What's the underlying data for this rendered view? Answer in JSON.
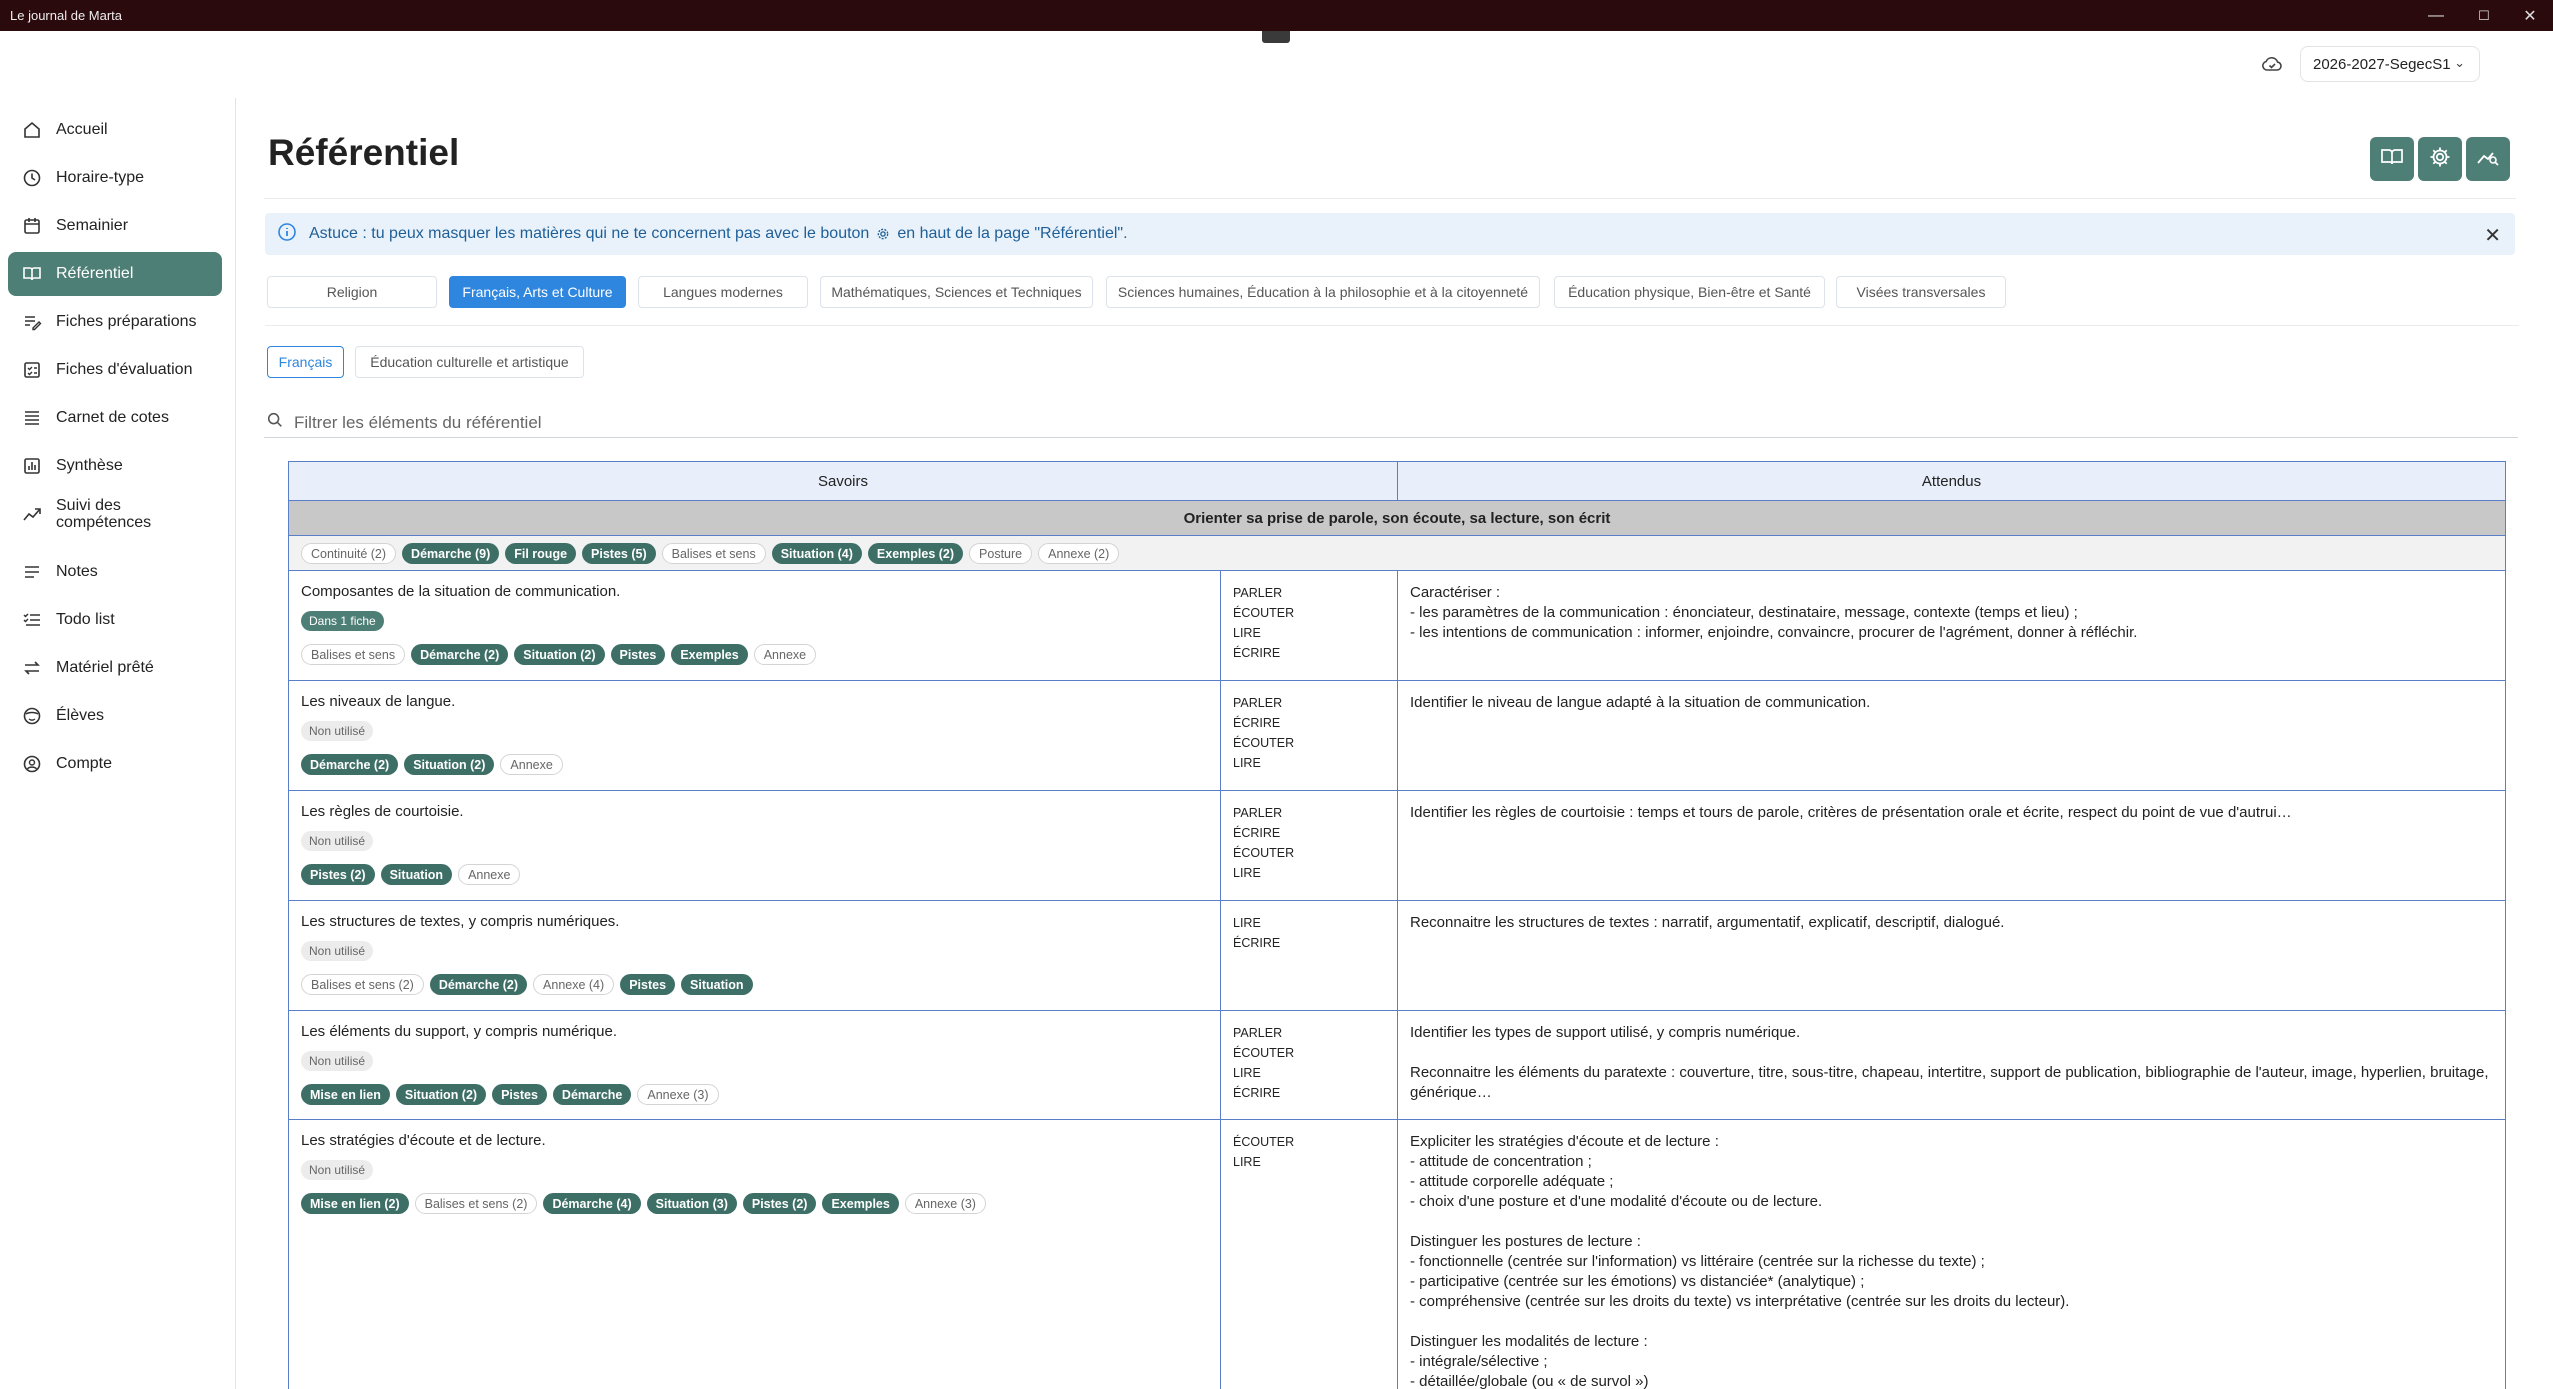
{
  "window": {
    "title": "Le journal de Marta",
    "minimize": "—",
    "maximize": "☐",
    "close": "✕"
  },
  "topbar": {
    "year": "2026-2027-SegecS1"
  },
  "sidebar": {
    "items": [
      {
        "label": "Accueil",
        "icon": "home-icon"
      },
      {
        "label": "Horaire-type",
        "icon": "clock-icon"
      },
      {
        "label": "Semainier",
        "icon": "calendar-icon"
      },
      {
        "label": "Référentiel",
        "icon": "book-icon",
        "active": true
      },
      {
        "label": "Fiches préparations",
        "icon": "edit-list-icon"
      },
      {
        "label": "Fiches d'évaluation",
        "icon": "checklist-icon"
      },
      {
        "label": "Carnet de cotes",
        "icon": "list-icon"
      },
      {
        "label": "Synthèse",
        "icon": "bar-chart-icon"
      },
      {
        "label": "Suivi des compétences",
        "icon": "trend-icon",
        "label_lines": [
          "Suivi des",
          "compétences"
        ]
      },
      {
        "label": "Notes",
        "icon": "notes-icon"
      },
      {
        "label": "Todo list",
        "icon": "todo-icon"
      },
      {
        "label": "Matériel prêté",
        "icon": "swap-icon"
      },
      {
        "label": "Élèves",
        "icon": "student-icon"
      },
      {
        "label": "Compte",
        "icon": "account-icon"
      }
    ]
  },
  "page": {
    "title": "Référentiel"
  },
  "tip": {
    "part1": "Astuce : tu peux masquer les matières qui ne te concernent pas avec le bouton",
    "part2": "en haut de la page \"Référentiel\"."
  },
  "domain_tabs": [
    "Religion",
    "Français, Arts et Culture",
    "Langues modernes",
    "Mathématiques, Sciences et Techniques",
    "Sciences humaines, Éducation à la philosophie et à la citoyenneté",
    "Éducation physique, Bien-être et Santé",
    "Visées transversales"
  ],
  "sub_tabs": [
    "Français",
    "Éducation culturelle et artistique"
  ],
  "filter": {
    "placeholder": "Filtrer les éléments du référentiel"
  },
  "table": {
    "headers": {
      "savoirs": "Savoirs",
      "attendus": "Attendus"
    },
    "section_title": "Orienter sa prise de parole, son écoute, sa lecture, son écrit",
    "section_tags": [
      {
        "label": "Continuité (2)",
        "filled": false
      },
      {
        "label": "Démarche (9)",
        "filled": true
      },
      {
        "label": "Fil rouge",
        "filled": true
      },
      {
        "label": "Pistes (5)",
        "filled": true
      },
      {
        "label": "Balises et sens",
        "filled": false
      },
      {
        "label": "Situation (4)",
        "filled": true
      },
      {
        "label": "Exemples (2)",
        "filled": true
      },
      {
        "label": "Posture",
        "filled": false
      },
      {
        "label": "Annexe (2)",
        "filled": false
      }
    ],
    "rows": [
      {
        "title": "Composantes de la situation de communication.",
        "status": "Dans 1 fiche",
        "used": true,
        "tags": [
          {
            "label": "Balises et sens",
            "filled": false
          },
          {
            "label": "Démarche (2)",
            "filled": true
          },
          {
            "label": "Situation (2)",
            "filled": true
          },
          {
            "label": "Pistes",
            "filled": true
          },
          {
            "label": "Exemples",
            "filled": true
          },
          {
            "label": "Annexe",
            "filled": false
          }
        ],
        "skills": [
          "PARLER",
          "ÉCOUTER",
          "LIRE",
          "ÉCRIRE"
        ],
        "attendus": "Caractériser :\n- les paramètres de la communication : énonciateur, destinataire, message, contexte (temps et lieu) ;\n- les intentions de communication : informer, enjoindre, convaincre, procurer de l'agrément, donner à réfléchir."
      },
      {
        "title": "Les niveaux de langue.",
        "status": "Non utilisé",
        "used": false,
        "tags": [
          {
            "label": "Démarche (2)",
            "filled": true
          },
          {
            "label": "Situation (2)",
            "filled": true
          },
          {
            "label": "Annexe",
            "filled": false
          }
        ],
        "skills": [
          "PARLER",
          "ÉCRIRE",
          "ÉCOUTER",
          "LIRE"
        ],
        "attendus": "Identifier le niveau de langue adapté à la situation de communication."
      },
      {
        "title": "Les règles de courtoisie.",
        "status": "Non utilisé",
        "used": false,
        "tags": [
          {
            "label": "Pistes (2)",
            "filled": true
          },
          {
            "label": "Situation",
            "filled": true
          },
          {
            "label": "Annexe",
            "filled": false
          }
        ],
        "skills": [
          "PARLER",
          "ÉCRIRE",
          "ÉCOUTER",
          "LIRE"
        ],
        "attendus": "Identifier les règles de courtoisie : temps et tours de parole, critères de présentation orale et écrite, respect du point de vue d'autrui…"
      },
      {
        "title": "Les structures de textes, y compris numériques.",
        "status": "Non utilisé",
        "used": false,
        "tags": [
          {
            "label": "Balises et sens (2)",
            "filled": false
          },
          {
            "label": "Démarche (2)",
            "filled": true
          },
          {
            "label": "Annexe (4)",
            "filled": false
          },
          {
            "label": "Pistes",
            "filled": true
          },
          {
            "label": "Situation",
            "filled": true
          }
        ],
        "skills": [
          "LIRE",
          "ÉCRIRE"
        ],
        "attendus": "Reconnaitre les structures de textes : narratif, argumentatif, explicatif, descriptif, dialogué."
      },
      {
        "title": "Les éléments du support, y compris numérique.",
        "status": "Non utilisé",
        "used": false,
        "tags": [
          {
            "label": "Mise en lien",
            "filled": true
          },
          {
            "label": "Situation (2)",
            "filled": true
          },
          {
            "label": "Pistes",
            "filled": true
          },
          {
            "label": "Démarche",
            "filled": true
          },
          {
            "label": "Annexe (3)",
            "filled": false
          }
        ],
        "skills": [
          "PARLER",
          "ÉCOUTER",
          "LIRE",
          "ÉCRIRE"
        ],
        "attendus": "Identifier les types de support utilisé, y compris numérique.\n\nReconnaitre les éléments du paratexte : couverture, titre, sous-titre, chapeau, intertitre, support de publication, bibliographie de l'auteur, image, hyperlien, bruitage, générique…"
      },
      {
        "title": "Les stratégies d'écoute et de lecture.",
        "status": "Non utilisé",
        "used": false,
        "tags": [
          {
            "label": "Mise en lien (2)",
            "filled": true
          },
          {
            "label": "Balises et sens (2)",
            "filled": false
          },
          {
            "label": "Démarche (4)",
            "filled": true
          },
          {
            "label": "Situation (3)",
            "filled": true
          },
          {
            "label": "Pistes (2)",
            "filled": true
          },
          {
            "label": "Exemples",
            "filled": true
          },
          {
            "label": "Annexe (3)",
            "filled": false
          }
        ],
        "skills": [
          "ÉCOUTER",
          "LIRE"
        ],
        "attendus": "Expliciter les stratégies d'écoute et de lecture :\n- attitude de concentration ;\n- attitude corporelle adéquate ;\n- choix d'une posture et d'une modalité d'écoute ou de lecture.\n\nDistinguer les postures de lecture :\n- fonctionnelle (centrée sur l'information) vs littéraire (centrée sur la richesse du texte) ;\n- participative (centrée sur les émotions) vs distanciée* (analytique) ;\n- compréhensive (centrée sur les droits du texte) vs interprétative (centrée sur les droits du lecteur).\n\nDistinguer les modalités de lecture :\n- intégrale/sélective ;\n- détaillée/globale (ou « de survol »)"
      }
    ]
  }
}
